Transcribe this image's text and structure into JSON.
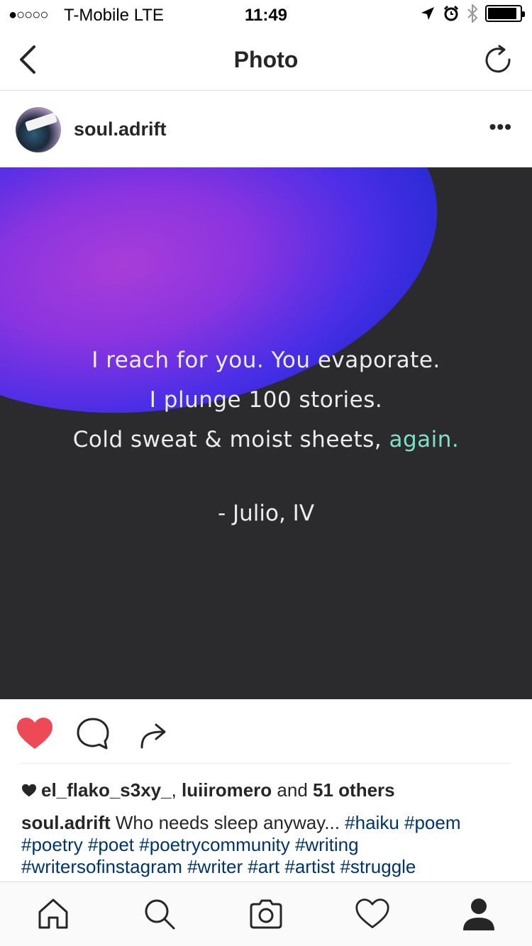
{
  "status_bar": {
    "signal": "●○○○○",
    "carrier": "T-Mobile  LTE",
    "time": "11:49",
    "battery_level": 0.9,
    "icons": [
      "location-icon",
      "alarm-icon",
      "bluetooth-icon",
      "battery-icon"
    ]
  },
  "nav": {
    "title": "Photo",
    "back_icon": "chevron-left-icon",
    "refresh_icon": "refresh-icon"
  },
  "post": {
    "username": "soul.adrift",
    "more_label": "•••",
    "image_text": {
      "lines": [
        "I reach for you. You evaporate.",
        "I plunge 100 stories."
      ],
      "line3_prefix": "Cold sweat & moist sheets, ",
      "line3_accent": "again.",
      "signature": "- Julio, IV"
    },
    "likes": {
      "user1": "el_flako_s3xy_",
      "separator": ", ",
      "user2": "luiiromero",
      "and": " and ",
      "others": "51 others"
    },
    "caption": {
      "username": "soul.adrift",
      "text": " Who needs sleep anyway... ",
      "hashtags": [
        "#haiku",
        "#poem",
        "#poetry",
        "#poet",
        "#poetrycommunity",
        "#writing",
        "#writersofinstagram",
        "#writer",
        "#art",
        "#artist",
        "#struggle"
      ]
    }
  },
  "colors": {
    "like_red": "#ed4956",
    "hashtag_blue": "#003569",
    "accent_teal": "#7fe0c8"
  },
  "tab_bar": [
    "home-icon",
    "search-icon",
    "camera-icon",
    "activity-heart-icon",
    "profile-icon"
  ]
}
